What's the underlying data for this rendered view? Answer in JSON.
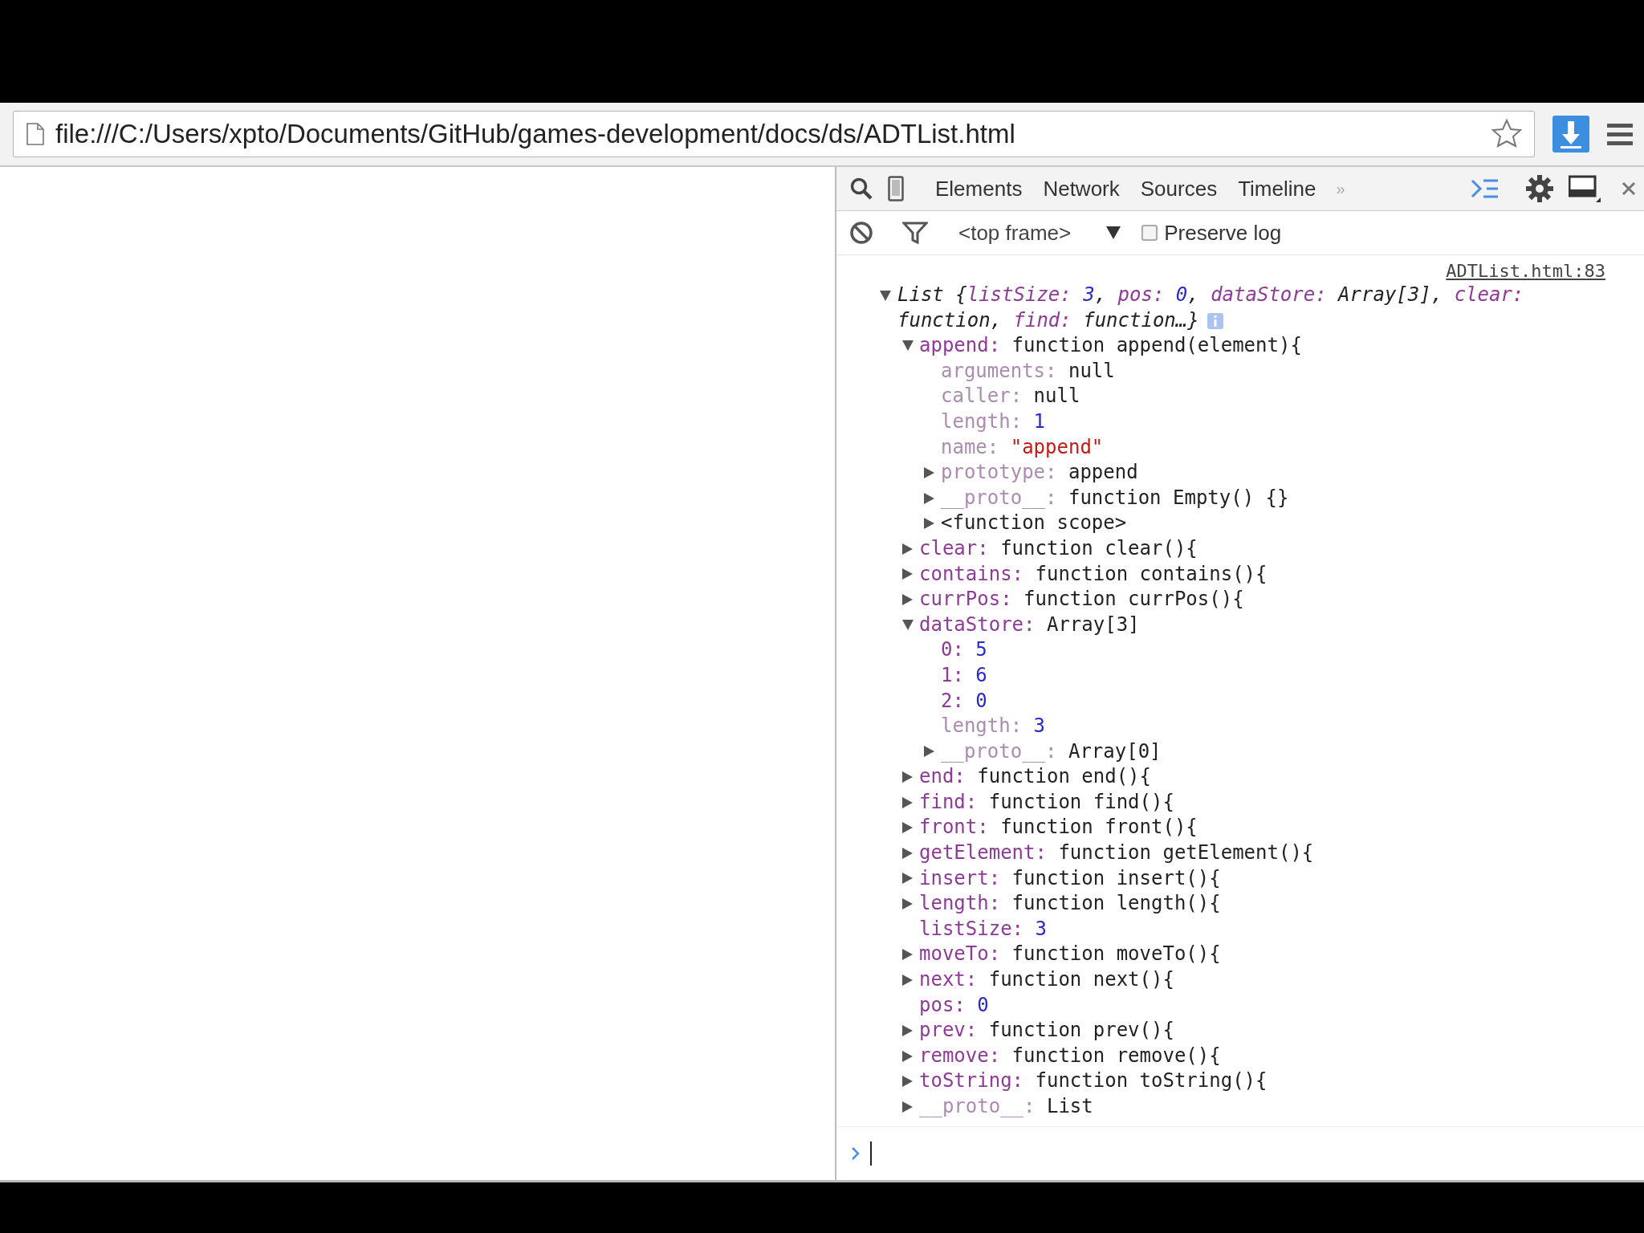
{
  "browser": {
    "url": "file:///C:/Users/xpto/Documents/GitHub/games-development/docs/ds/ADTList.html"
  },
  "devtools": {
    "tabs": [
      "Elements",
      "Network",
      "Sources",
      "Timeline"
    ],
    "overflow": "»",
    "frame_selector": {
      "value": "<top frame>"
    },
    "preserve_log": {
      "label": "Preserve log",
      "checked": false
    },
    "console": {
      "source": "ADTList.html:83",
      "object": {
        "expanded": true,
        "summary_lines": [
          [
            {
              "text": "List {",
              "kind": "plain"
            },
            {
              "text": "listSize: ",
              "kind": "key"
            },
            {
              "text": "3",
              "kind": "number"
            },
            {
              "text": ", ",
              "kind": "plain"
            },
            {
              "text": "pos: ",
              "kind": "key"
            },
            {
              "text": "0",
              "kind": "number"
            },
            {
              "text": ", ",
              "kind": "plain"
            },
            {
              "text": "dataStore:",
              "kind": "key"
            },
            {
              "text": " Array[3], ",
              "kind": "plain"
            },
            {
              "text": "clear:",
              "kind": "key"
            }
          ],
          [
            {
              "text": "function, ",
              "kind": "plain"
            },
            {
              "text": "find:",
              "kind": "key"
            },
            {
              "text": " function…}",
              "kind": "plain"
            }
          ]
        ],
        "children": [
          {
            "key": {
              "text": "append:",
              "kind": "own"
            },
            "value": {
              "text": "function append(element){",
              "kind": "plain"
            },
            "expanded": true,
            "children": [
              {
                "key": {
                  "text": "arguments:",
                  "kind": "internal"
                },
                "value": {
                  "text": "null",
                  "kind": "plain"
                }
              },
              {
                "key": {
                  "text": "caller:",
                  "kind": "internal"
                },
                "value": {
                  "text": "null",
                  "kind": "plain"
                }
              },
              {
                "key": {
                  "text": "length:",
                  "kind": "internal"
                },
                "value": {
                  "text": "1",
                  "kind": "number"
                }
              },
              {
                "key": {
                  "text": "name:",
                  "kind": "internal"
                },
                "value": {
                  "text": "\"append\"",
                  "kind": "string"
                }
              },
              {
                "key": {
                  "text": "prototype:",
                  "kind": "internal"
                },
                "value": {
                  "text": "append",
                  "kind": "plain"
                },
                "expanded": false
              },
              {
                "key": {
                  "text": "__proto__:",
                  "kind": "internal"
                },
                "value": {
                  "text": "function Empty() {}",
                  "kind": "plain"
                },
                "expanded": false
              },
              {
                "key": {
                  "text": "<function scope>",
                  "kind": "scope"
                },
                "expanded": false
              }
            ]
          },
          {
            "key": {
              "text": "clear:",
              "kind": "own"
            },
            "value": {
              "text": "function clear(){",
              "kind": "plain"
            },
            "expanded": false
          },
          {
            "key": {
              "text": "contains:",
              "kind": "own"
            },
            "value": {
              "text": "function contains(){",
              "kind": "plain"
            },
            "expanded": false
          },
          {
            "key": {
              "text": "currPos:",
              "kind": "own"
            },
            "value": {
              "text": "function currPos(){",
              "kind": "plain"
            },
            "expanded": false
          },
          {
            "key": {
              "text": "dataStore:",
              "kind": "own"
            },
            "value": {
              "text": "Array[3]",
              "kind": "plain"
            },
            "expanded": true,
            "children": [
              {
                "key": {
                  "text": "0:",
                  "kind": "own"
                },
                "value": {
                  "text": "5",
                  "kind": "number"
                }
              },
              {
                "key": {
                  "text": "1:",
                  "kind": "own"
                },
                "value": {
                  "text": "6",
                  "kind": "number"
                }
              },
              {
                "key": {
                  "text": "2:",
                  "kind": "own"
                },
                "value": {
                  "text": "0",
                  "kind": "number"
                }
              },
              {
                "key": {
                  "text": "length:",
                  "kind": "internal"
                },
                "value": {
                  "text": "3",
                  "kind": "number"
                }
              },
              {
                "key": {
                  "text": "__proto__:",
                  "kind": "internal"
                },
                "value": {
                  "text": "Array[0]",
                  "kind": "plain"
                },
                "expanded": false
              }
            ]
          },
          {
            "key": {
              "text": "end:",
              "kind": "own"
            },
            "value": {
              "text": "function end(){",
              "kind": "plain"
            },
            "expanded": false
          },
          {
            "key": {
              "text": "find:",
              "kind": "own"
            },
            "value": {
              "text": "function find(){",
              "kind": "plain"
            },
            "expanded": false
          },
          {
            "key": {
              "text": "front:",
              "kind": "own"
            },
            "value": {
              "text": "function front(){",
              "kind": "plain"
            },
            "expanded": false
          },
          {
            "key": {
              "text": "getElement:",
              "kind": "own"
            },
            "value": {
              "text": "function getElement(){",
              "kind": "plain"
            },
            "expanded": false
          },
          {
            "key": {
              "text": "insert:",
              "kind": "own"
            },
            "value": {
              "text": "function insert(){",
              "kind": "plain"
            },
            "expanded": false
          },
          {
            "key": {
              "text": "length:",
              "kind": "own"
            },
            "value": {
              "text": "function length(){",
              "kind": "plain"
            },
            "expanded": false
          },
          {
            "key": {
              "text": "listSize:",
              "kind": "own"
            },
            "value": {
              "text": "3",
              "kind": "number"
            }
          },
          {
            "key": {
              "text": "moveTo:",
              "kind": "own"
            },
            "value": {
              "text": "function moveTo(){",
              "kind": "plain"
            },
            "expanded": false
          },
          {
            "key": {
              "text": "next:",
              "kind": "own"
            },
            "value": {
              "text": "function next(){",
              "kind": "plain"
            },
            "expanded": false
          },
          {
            "key": {
              "text": "pos:",
              "kind": "own"
            },
            "value": {
              "text": "0",
              "kind": "number"
            }
          },
          {
            "key": {
              "text": "prev:",
              "kind": "own"
            },
            "value": {
              "text": "function prev(){",
              "kind": "plain"
            },
            "expanded": false
          },
          {
            "key": {
              "text": "remove:",
              "kind": "own"
            },
            "value": {
              "text": "function remove(){",
              "kind": "plain"
            },
            "expanded": false
          },
          {
            "key": {
              "text": "toString:",
              "kind": "own"
            },
            "value": {
              "text": "function toString(){",
              "kind": "plain"
            },
            "expanded": false
          },
          {
            "key": {
              "text": "__proto__:",
              "kind": "internal"
            },
            "value": {
              "text": "List",
              "kind": "plain"
            },
            "expanded": false
          }
        ]
      }
    }
  }
}
